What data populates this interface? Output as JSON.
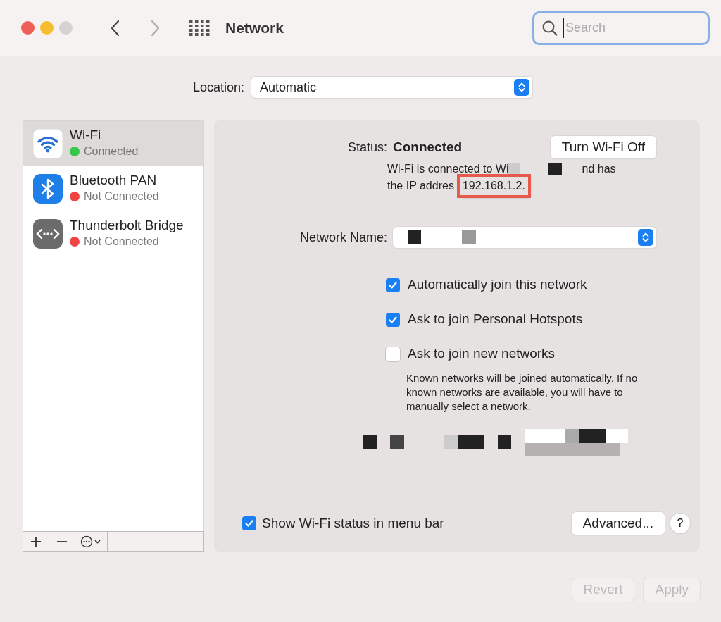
{
  "window": {
    "title": "Network"
  },
  "search": {
    "placeholder": "Search",
    "focused": true
  },
  "location": {
    "label": "Location:",
    "value": "Automatic"
  },
  "services": [
    {
      "name": "Wi-Fi",
      "status": "Connected",
      "color": "#34c749",
      "kind": "wifi",
      "selected": true
    },
    {
      "name": "Bluetooth PAN",
      "status": "Not Connected",
      "color": "#ee4444",
      "kind": "bluetooth",
      "selected": false
    },
    {
      "name": "Thunderbolt Bridge",
      "status": "Not Connected",
      "color": "#ee4444",
      "kind": "bridge",
      "selected": false
    }
  ],
  "status": {
    "label": "Status:",
    "value": "Connected",
    "button": "Turn Wi-Fi Off",
    "message_start": "Wi-Fi is connected to Wi",
    "message_middle": "nd has",
    "message_end": "the IP addres",
    "ip_address": "192.168.1.2."
  },
  "network_name": {
    "label": "Network Name:"
  },
  "options": [
    {
      "label": "Automatically join this network",
      "checked": true
    },
    {
      "label": "Ask to join Personal Hotspots",
      "checked": true
    },
    {
      "label": "Ask to join new networks",
      "checked": false
    }
  ],
  "note": "Known networks will be joined automatically. If no known networks are available, you will have to manually select a network.",
  "show_status": {
    "label": "Show Wi-Fi status in menu bar",
    "checked": true
  },
  "advanced_button": "Advanced...",
  "help_button": "?",
  "footer_buttons": [
    {
      "label": "Revert",
      "disabled": true
    },
    {
      "label": "Apply",
      "disabled": true
    }
  ]
}
